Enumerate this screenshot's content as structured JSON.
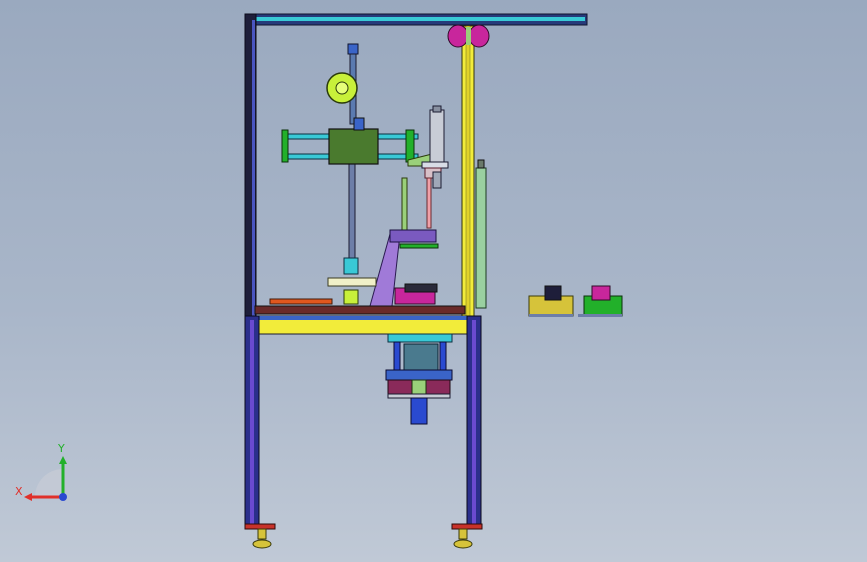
{
  "viewport": {
    "background_top": "#9aa9bf",
    "background_bottom": "#c0c9d6"
  },
  "triad": {
    "x_label": "X",
    "y_label": "Y",
    "x_color": "#e0302a",
    "y_color": "#22b02a",
    "z_color": "#2a4ad0"
  },
  "colors": {
    "frame_blue": "#2b2f8c",
    "frame_dark": "#1e1e3a",
    "rail_yellow": "#f2ec3a",
    "rail_cyan": "#39c9d6",
    "plate_green": "#4a7a2e",
    "wheel_lime": "#c8f03a",
    "accent_purple": "#a07ad8",
    "accent_magenta": "#c8269c",
    "accent_orange": "#e0571e",
    "foot_red": "#c8322a",
    "foot_gold": "#d6c33a"
  }
}
